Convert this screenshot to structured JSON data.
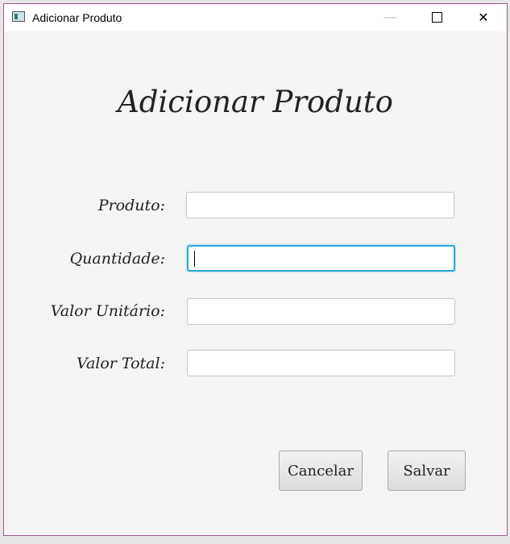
{
  "window": {
    "title": "Adicionar Produto",
    "controls": {
      "minimize": "—",
      "close": "✕"
    }
  },
  "form": {
    "heading": "Adicionar Produto",
    "fields": [
      {
        "label": "Produto:",
        "value": ""
      },
      {
        "label": "Quantidade:",
        "value": ""
      },
      {
        "label": "Valor Unitário:",
        "value": ""
      },
      {
        "label": "Valor Total:",
        "value": ""
      }
    ],
    "buttons": {
      "cancel": "Cancelar",
      "save": "Salvar"
    }
  }
}
